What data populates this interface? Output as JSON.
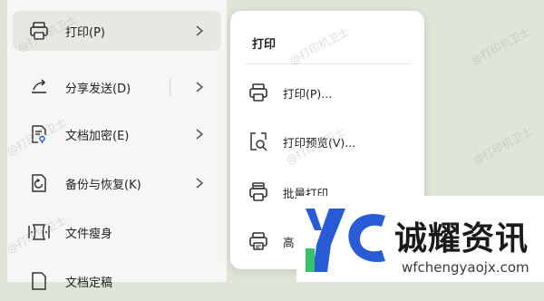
{
  "menu": {
    "items": [
      {
        "label": "打印(P)",
        "icon": "printer-icon"
      },
      {
        "label": "分享发送(D)",
        "icon": "share-icon"
      },
      {
        "label": "文档加密(E)",
        "icon": "lock-document-icon"
      },
      {
        "label": "备份与恢复(K)",
        "icon": "backup-icon"
      },
      {
        "label": "文件瘦身",
        "icon": "slim-file-icon"
      },
      {
        "label": "文档定稿",
        "icon": "finalize-document-icon"
      }
    ]
  },
  "submenu": {
    "title": "打印",
    "items": [
      {
        "label": "打印(P)...",
        "icon": "printer-icon"
      },
      {
        "label": "打印预览(V)...",
        "icon": "print-preview-icon"
      },
      {
        "label": "批量打印...",
        "icon": "batch-print-icon"
      },
      {
        "label": "高",
        "icon": "advanced-print-icon"
      }
    ]
  },
  "watermark": {
    "text": "@打印机卫士"
  },
  "brand": {
    "title": "诚耀资讯",
    "url": "wfchengyaojx.com",
    "colors": {
      "blue": "#2a5bd7",
      "green": "#36c26b"
    }
  }
}
